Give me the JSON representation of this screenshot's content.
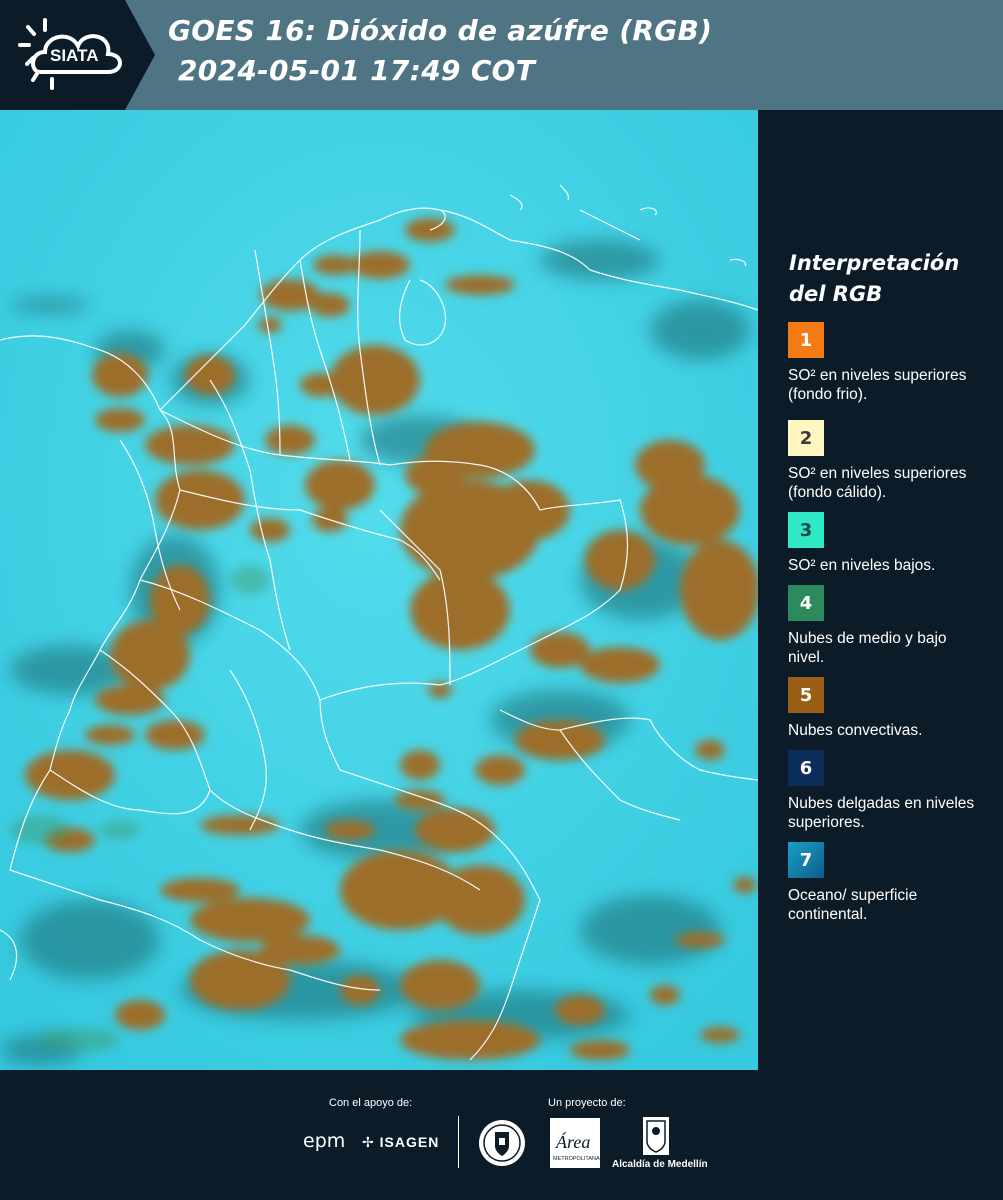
{
  "header": {
    "logo_text": "SIATA",
    "title_line1": "GOES 16: Dióxido de azúfre (RGB)",
    "title_line2": "2024-05-01 17:49 COT"
  },
  "map": {
    "description_colors": {
      "ocean_and_surface": "#3fd3e6",
      "convective_clouds": "#9c6e2a",
      "cloud_shadow": "#1c5c62",
      "borders": "#ffffff"
    }
  },
  "legend": {
    "title": "Interpretación del RGB",
    "items": [
      {
        "number": "1",
        "color": "#f57c14",
        "number_color": "#ffffff",
        "label": "SO² en niveles superiores (fondo frio)."
      },
      {
        "number": "2",
        "color": "#fff7c2",
        "number_color": "#3a3a3a",
        "label": "SO² en niveles superiores (fondo cálido)."
      },
      {
        "number": "3",
        "color": "#2ee8c6",
        "number_color": "#1b4c48",
        "label": "SO² en niveles bajos."
      },
      {
        "number": "4",
        "color": "#2d8a5c",
        "number_color": "#ffffff",
        "label": "Nubes de medio y bajo nivel."
      },
      {
        "number": "5",
        "color": "#9a5f14",
        "number_color": "#ffffff",
        "label": "Nubes convectivas."
      },
      {
        "number": "6",
        "color": "#0c2e5a",
        "number_color": "#ffffff",
        "label": "Nubes delgadas en niveles superiores."
      },
      {
        "number": "7",
        "color": "#1b8bb4",
        "number_color": "#ffffff",
        "label": "Oceano/ superficie continental."
      }
    ]
  },
  "footer": {
    "support_label": "Con el apoyo de:",
    "project_label": "Un proyecto de:",
    "epm": "epm",
    "isagen": "ISAGEN",
    "area_logo_text": "Área",
    "area_logo_subtext": "METROPOLITANA",
    "alcaldia": "Alcaldía de Medellín"
  }
}
